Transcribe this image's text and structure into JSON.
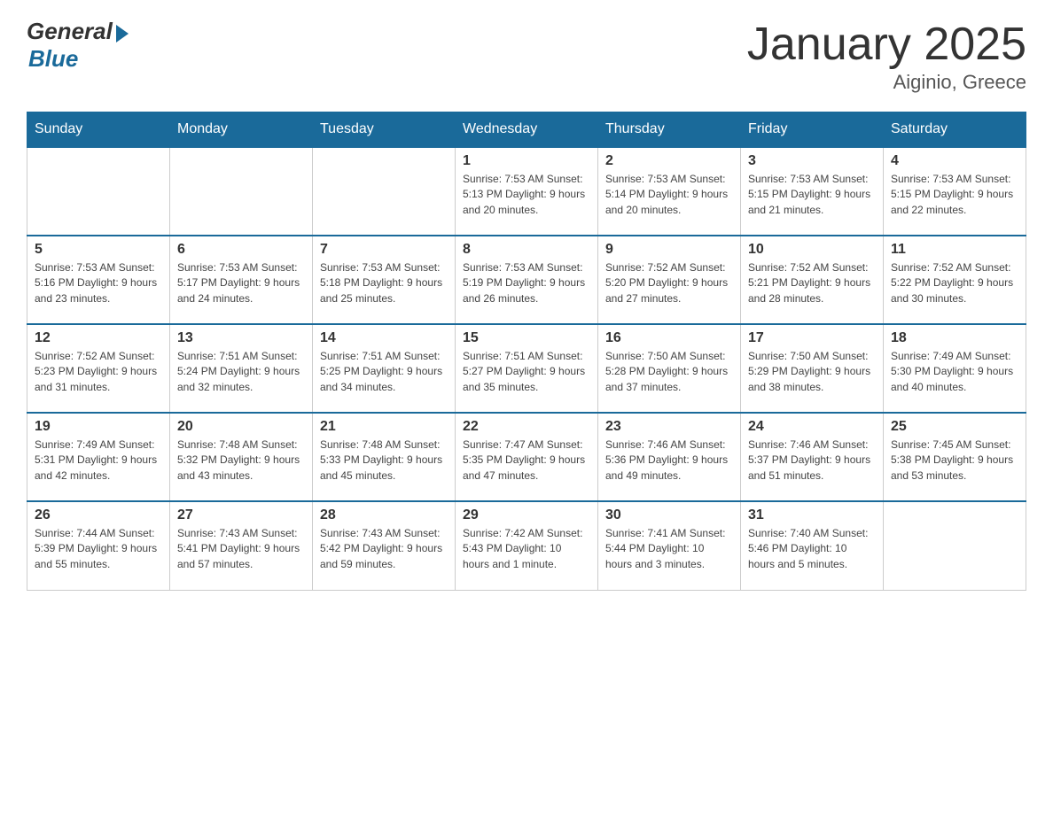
{
  "header": {
    "logo_general": "General",
    "logo_blue": "Blue",
    "month_title": "January 2025",
    "location": "Aiginio, Greece"
  },
  "days_of_week": [
    "Sunday",
    "Monday",
    "Tuesday",
    "Wednesday",
    "Thursday",
    "Friday",
    "Saturday"
  ],
  "weeks": [
    [
      {
        "day": "",
        "info": ""
      },
      {
        "day": "",
        "info": ""
      },
      {
        "day": "",
        "info": ""
      },
      {
        "day": "1",
        "info": "Sunrise: 7:53 AM\nSunset: 5:13 PM\nDaylight: 9 hours\nand 20 minutes."
      },
      {
        "day": "2",
        "info": "Sunrise: 7:53 AM\nSunset: 5:14 PM\nDaylight: 9 hours\nand 20 minutes."
      },
      {
        "day": "3",
        "info": "Sunrise: 7:53 AM\nSunset: 5:15 PM\nDaylight: 9 hours\nand 21 minutes."
      },
      {
        "day": "4",
        "info": "Sunrise: 7:53 AM\nSunset: 5:15 PM\nDaylight: 9 hours\nand 22 minutes."
      }
    ],
    [
      {
        "day": "5",
        "info": "Sunrise: 7:53 AM\nSunset: 5:16 PM\nDaylight: 9 hours\nand 23 minutes."
      },
      {
        "day": "6",
        "info": "Sunrise: 7:53 AM\nSunset: 5:17 PM\nDaylight: 9 hours\nand 24 minutes."
      },
      {
        "day": "7",
        "info": "Sunrise: 7:53 AM\nSunset: 5:18 PM\nDaylight: 9 hours\nand 25 minutes."
      },
      {
        "day": "8",
        "info": "Sunrise: 7:53 AM\nSunset: 5:19 PM\nDaylight: 9 hours\nand 26 minutes."
      },
      {
        "day": "9",
        "info": "Sunrise: 7:52 AM\nSunset: 5:20 PM\nDaylight: 9 hours\nand 27 minutes."
      },
      {
        "day": "10",
        "info": "Sunrise: 7:52 AM\nSunset: 5:21 PM\nDaylight: 9 hours\nand 28 minutes."
      },
      {
        "day": "11",
        "info": "Sunrise: 7:52 AM\nSunset: 5:22 PM\nDaylight: 9 hours\nand 30 minutes."
      }
    ],
    [
      {
        "day": "12",
        "info": "Sunrise: 7:52 AM\nSunset: 5:23 PM\nDaylight: 9 hours\nand 31 minutes."
      },
      {
        "day": "13",
        "info": "Sunrise: 7:51 AM\nSunset: 5:24 PM\nDaylight: 9 hours\nand 32 minutes."
      },
      {
        "day": "14",
        "info": "Sunrise: 7:51 AM\nSunset: 5:25 PM\nDaylight: 9 hours\nand 34 minutes."
      },
      {
        "day": "15",
        "info": "Sunrise: 7:51 AM\nSunset: 5:27 PM\nDaylight: 9 hours\nand 35 minutes."
      },
      {
        "day": "16",
        "info": "Sunrise: 7:50 AM\nSunset: 5:28 PM\nDaylight: 9 hours\nand 37 minutes."
      },
      {
        "day": "17",
        "info": "Sunrise: 7:50 AM\nSunset: 5:29 PM\nDaylight: 9 hours\nand 38 minutes."
      },
      {
        "day": "18",
        "info": "Sunrise: 7:49 AM\nSunset: 5:30 PM\nDaylight: 9 hours\nand 40 minutes."
      }
    ],
    [
      {
        "day": "19",
        "info": "Sunrise: 7:49 AM\nSunset: 5:31 PM\nDaylight: 9 hours\nand 42 minutes."
      },
      {
        "day": "20",
        "info": "Sunrise: 7:48 AM\nSunset: 5:32 PM\nDaylight: 9 hours\nand 43 minutes."
      },
      {
        "day": "21",
        "info": "Sunrise: 7:48 AM\nSunset: 5:33 PM\nDaylight: 9 hours\nand 45 minutes."
      },
      {
        "day": "22",
        "info": "Sunrise: 7:47 AM\nSunset: 5:35 PM\nDaylight: 9 hours\nand 47 minutes."
      },
      {
        "day": "23",
        "info": "Sunrise: 7:46 AM\nSunset: 5:36 PM\nDaylight: 9 hours\nand 49 minutes."
      },
      {
        "day": "24",
        "info": "Sunrise: 7:46 AM\nSunset: 5:37 PM\nDaylight: 9 hours\nand 51 minutes."
      },
      {
        "day": "25",
        "info": "Sunrise: 7:45 AM\nSunset: 5:38 PM\nDaylight: 9 hours\nand 53 minutes."
      }
    ],
    [
      {
        "day": "26",
        "info": "Sunrise: 7:44 AM\nSunset: 5:39 PM\nDaylight: 9 hours\nand 55 minutes."
      },
      {
        "day": "27",
        "info": "Sunrise: 7:43 AM\nSunset: 5:41 PM\nDaylight: 9 hours\nand 57 minutes."
      },
      {
        "day": "28",
        "info": "Sunrise: 7:43 AM\nSunset: 5:42 PM\nDaylight: 9 hours\nand 59 minutes."
      },
      {
        "day": "29",
        "info": "Sunrise: 7:42 AM\nSunset: 5:43 PM\nDaylight: 10 hours\nand 1 minute."
      },
      {
        "day": "30",
        "info": "Sunrise: 7:41 AM\nSunset: 5:44 PM\nDaylight: 10 hours\nand 3 minutes."
      },
      {
        "day": "31",
        "info": "Sunrise: 7:40 AM\nSunset: 5:46 PM\nDaylight: 10 hours\nand 5 minutes."
      },
      {
        "day": "",
        "info": ""
      }
    ]
  ],
  "colors": {
    "header_bg": "#1a6a9a",
    "header_text": "#ffffff",
    "border": "#cccccc"
  }
}
